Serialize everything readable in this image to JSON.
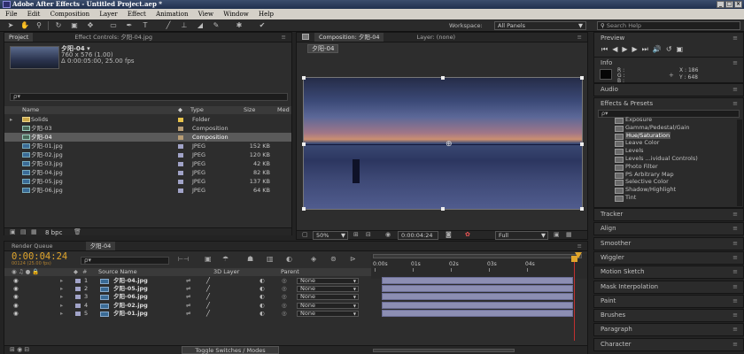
{
  "window": {
    "title": "Adobe After Effects - Untitled Project.aep *"
  },
  "menu": [
    "File",
    "Edit",
    "Composition",
    "Layer",
    "Effect",
    "Animation",
    "View",
    "Window",
    "Help"
  ],
  "workspace": {
    "label": "Workspace:",
    "value": "All Panels"
  },
  "search_help": {
    "placeholder": "Search Help"
  },
  "project_panel": {
    "tabs": [
      "Project",
      "Effect Controls: 夕阳-04.jpg"
    ],
    "item_name": "夕阳-04 ▾",
    "item_info1": "760 x 576 (1.00)",
    "item_info2": "Δ 0:00:05:00, 25.00 fps",
    "search_placeholder": "ρ▾",
    "columns": {
      "name": "Name",
      "type": "Type",
      "size": "Size",
      "media": "Med"
    },
    "files": [
      {
        "name": "Solids",
        "type": "Folder",
        "size": "",
        "label_color": "#e8c34a",
        "kind": "folder"
      },
      {
        "name": "夕阳-03",
        "type": "Composition",
        "size": "",
        "label_color": "#b89d74",
        "kind": "comp"
      },
      {
        "name": "夕阳-04",
        "type": "Composition",
        "size": "",
        "label_color": "#b89d74",
        "kind": "comp"
      },
      {
        "name": "夕阳-01.jpg",
        "type": "JPEG",
        "size": "152 KB",
        "label_color": "#a1a3c8",
        "kind": "image"
      },
      {
        "name": "夕阳-02.jpg",
        "type": "JPEG",
        "size": "120 KB",
        "label_color": "#a1a3c8",
        "kind": "image"
      },
      {
        "name": "夕阳-03.jpg",
        "type": "JPEG",
        "size": "42 KB",
        "label_color": "#a1a3c8",
        "kind": "image"
      },
      {
        "name": "夕阳-04.jpg",
        "type": "JPEG",
        "size": "82 KB",
        "label_color": "#a1a3c8",
        "kind": "image"
      },
      {
        "name": "夕阳-05.jpg",
        "type": "JPEG",
        "size": "137 KB",
        "label_color": "#a1a3c8",
        "kind": "image"
      },
      {
        "name": "夕阳-06.jpg",
        "type": "JPEG",
        "size": "64 KB",
        "label_color": "#a1a3c8",
        "kind": "image"
      }
    ],
    "footer_bpc": "8 bpc"
  },
  "comp_panel": {
    "tab": "Composition: 夕阳-04",
    "layer_tab": "Layer: (none)",
    "comp_chip": "夕阳-04",
    "zoom": "50%",
    "timecode": "0:00:04:24",
    "resolution": "Full"
  },
  "right_panels": {
    "preview": "Preview",
    "info": "Info",
    "info_rgb": [
      "R :",
      "G :",
      "B :"
    ],
    "info_x": "X : 186",
    "info_y": "Y : 648",
    "audio": "Audio",
    "effects_presets": "Effects & Presets",
    "effects_search": "ρ▾",
    "effects": [
      "Exposure",
      "Gamma/Pedestal/Gain",
      "Hue/Saturation",
      "Leave Color",
      "Levels",
      "Levels ...ividual Controls)",
      "Photo Filter",
      "PS Arbitrary Map",
      "Selective Color",
      "Shadow/Highlight",
      "Tint"
    ],
    "selected_effect": "Hue/Saturation",
    "collapsed": [
      "Tracker",
      "Align",
      "Smoother",
      "Wiggler",
      "Motion Sketch",
      "Mask Interpolation",
      "Paint",
      "Brushes",
      "Paragraph",
      "Character"
    ]
  },
  "timeline": {
    "tabs": [
      "Render Queue",
      "夕阳-04"
    ],
    "timecode": "0:00:04:24",
    "frames": "00124 (25.00 fps)",
    "search_placeholder": "ρ▾",
    "col_source": "Source Name",
    "col_3d": "3D Layer",
    "col_parent": "Parent",
    "ruler": [
      "0:00s",
      "01s",
      "02s",
      "03s",
      "04s"
    ],
    "layers": [
      {
        "num": "1",
        "name": "夕阳-04.jpg",
        "parent": "None"
      },
      {
        "num": "2",
        "name": "夕阳-05.jpg",
        "parent": "None"
      },
      {
        "num": "3",
        "name": "夕阳-06.jpg",
        "parent": "None"
      },
      {
        "num": "4",
        "name": "夕阳-02.jpg",
        "parent": "None"
      },
      {
        "num": "5",
        "name": "夕阳-01.jpg",
        "parent": "None"
      }
    ],
    "toggle_label": "Toggle Switches / Modes"
  },
  "colors": {
    "accent_timecode": "#e0a52c",
    "playhead": "#c03030",
    "layer_bar": "#8c8eb3"
  }
}
